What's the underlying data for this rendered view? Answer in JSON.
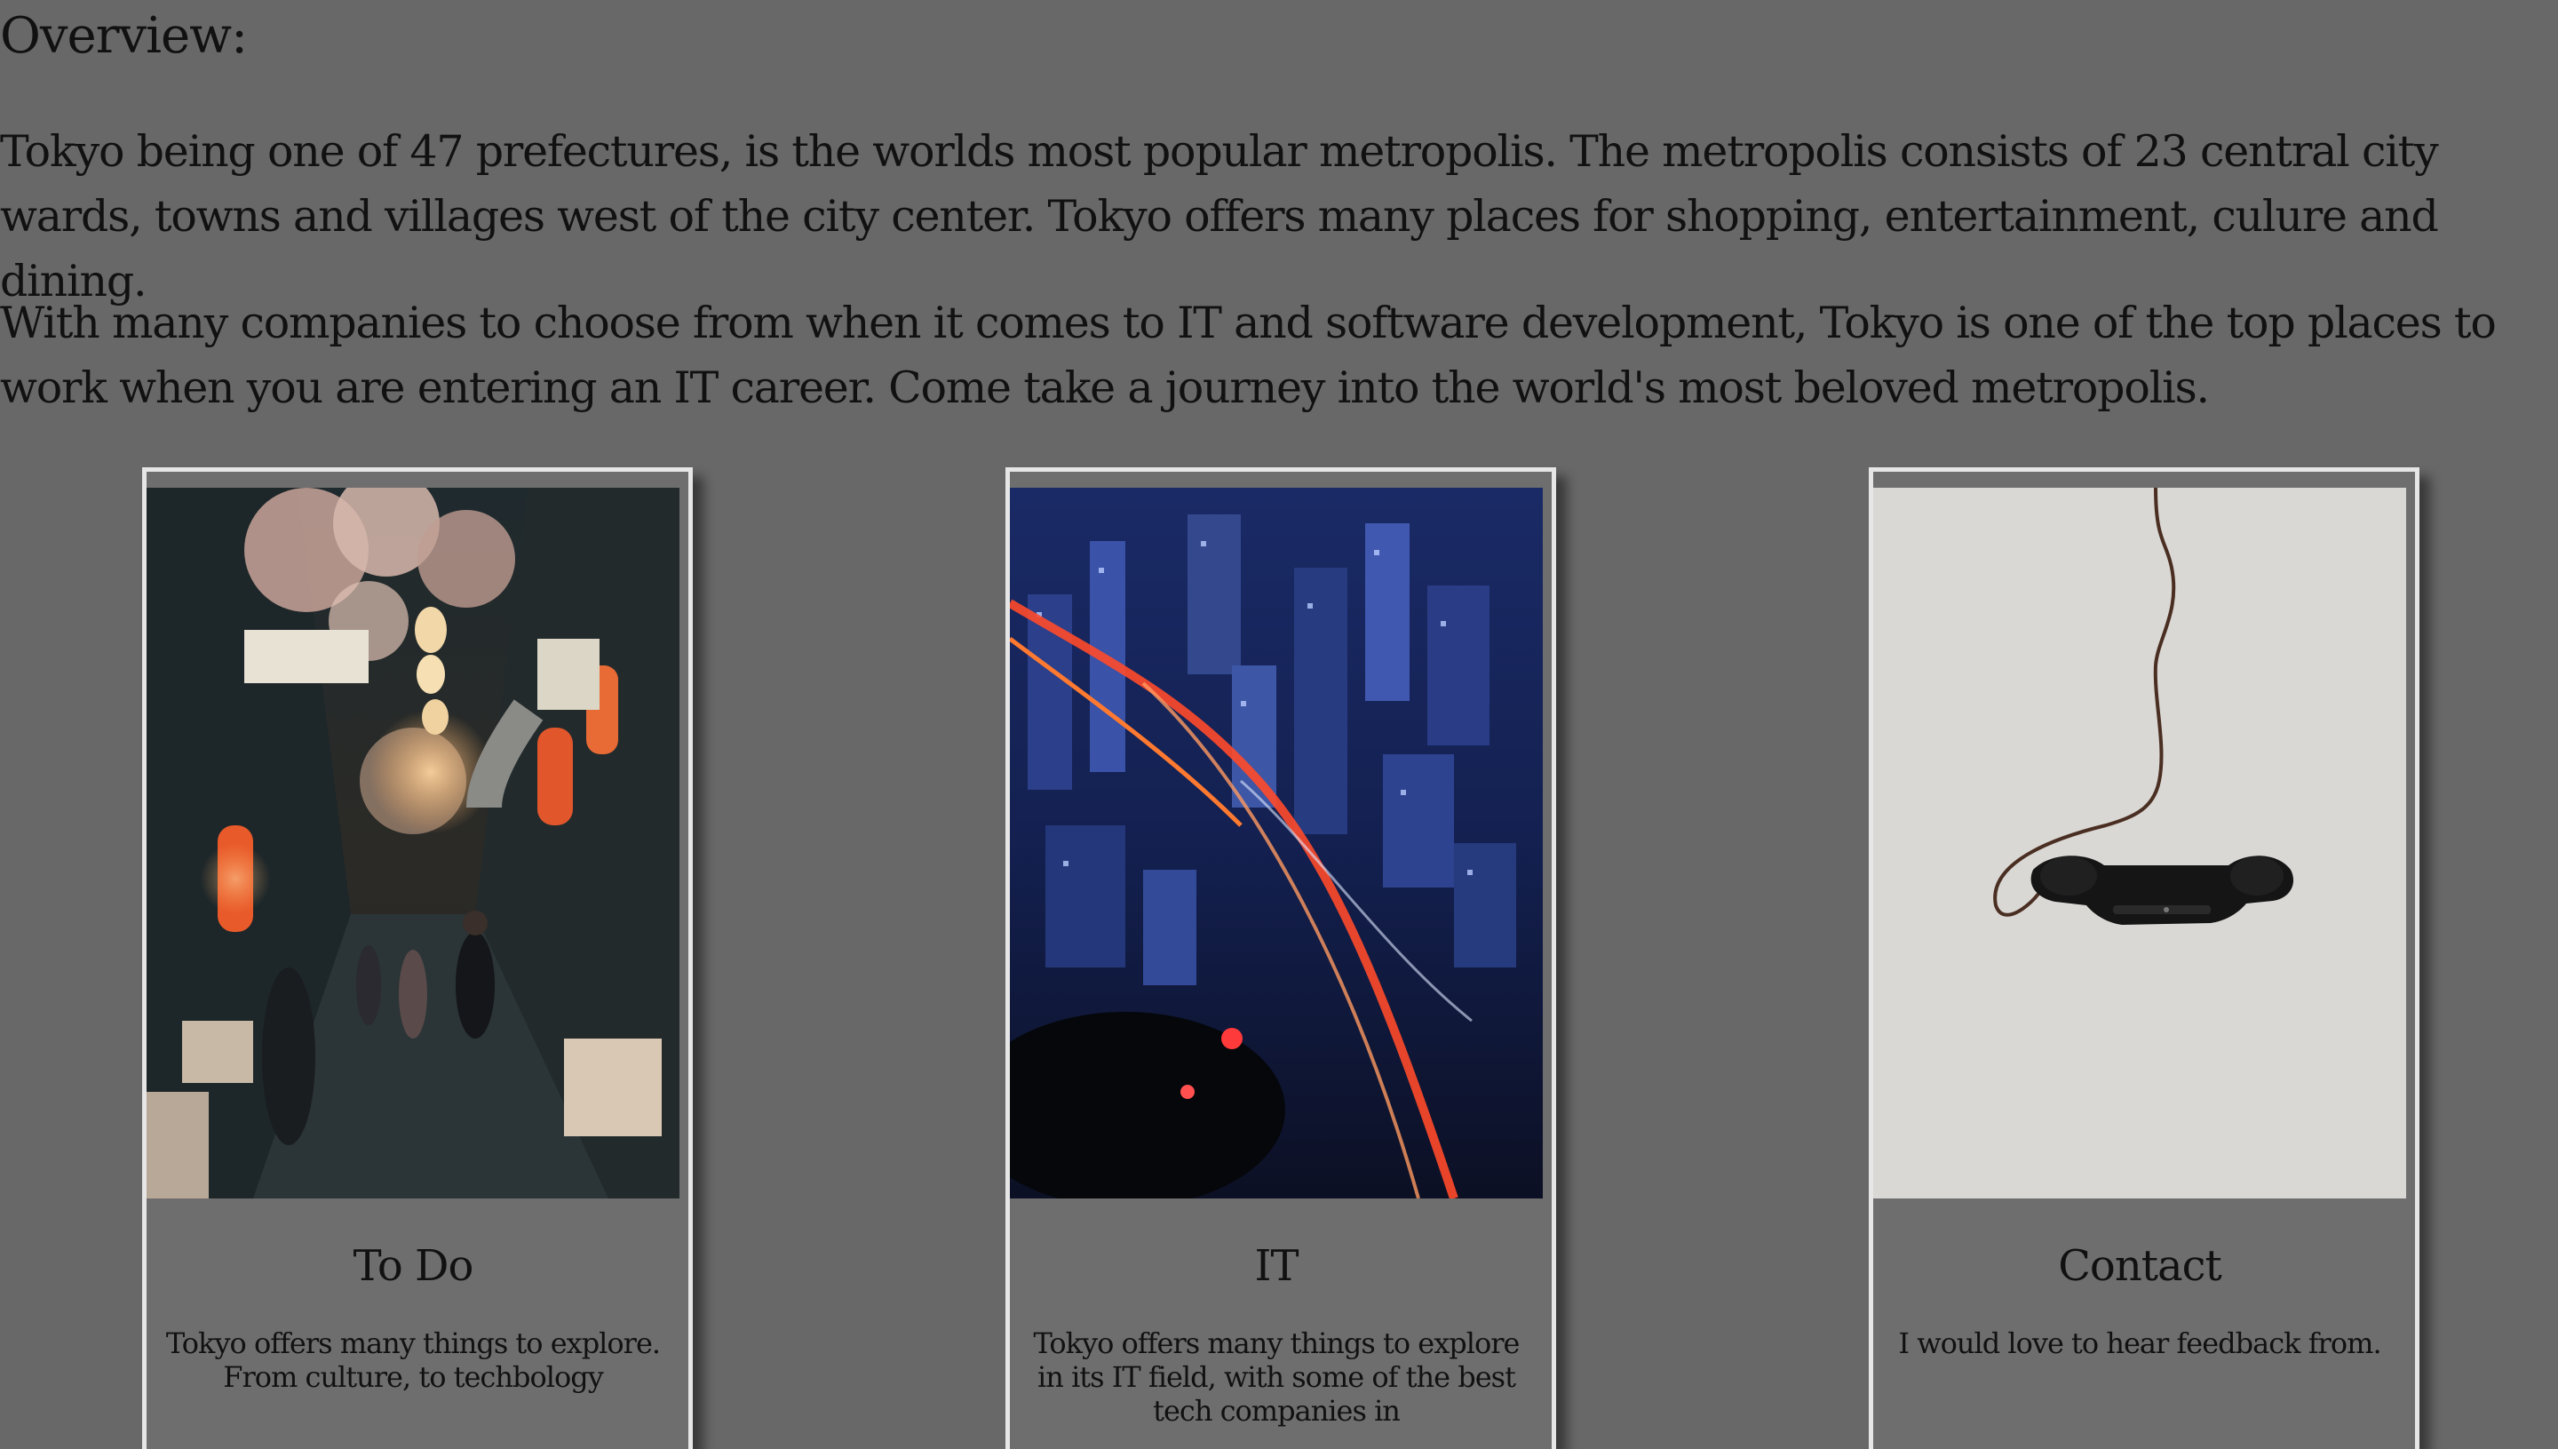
{
  "overview": {
    "heading": "Overview:",
    "paragraph_1": "Tokyo being one of 47 prefectures, is the worlds most popular metropolis. The metropolis consists of 23 central city wards, towns and villages west of the city center. Tokyo offers many places for shopping, entertainment, culure and dining.",
    "paragraph_2": "With many companies to choose from when it comes to IT and software development, Tokyo is one of the top places to work when you are entering an IT career. Come take a journey into the world's most beloved metropolis."
  },
  "cards": [
    {
      "title": "To Do",
      "description": "Tokyo offers many things to explore. From culture, to techbology",
      "image": "tokyo-alley-lanterns-photo"
    },
    {
      "title": "IT",
      "description": "Tokyo offers many things to explore in its IT field, with some of the best tech companies in",
      "image": "tokyo-city-night-aerial-photo"
    },
    {
      "title": "Contact",
      "description": "I would love to hear feedback from.",
      "image": "hanging-telephone-handset-photo"
    }
  ],
  "colors": {
    "background": "#686868",
    "card_border": "#e6e6e6",
    "text": "#111111"
  }
}
